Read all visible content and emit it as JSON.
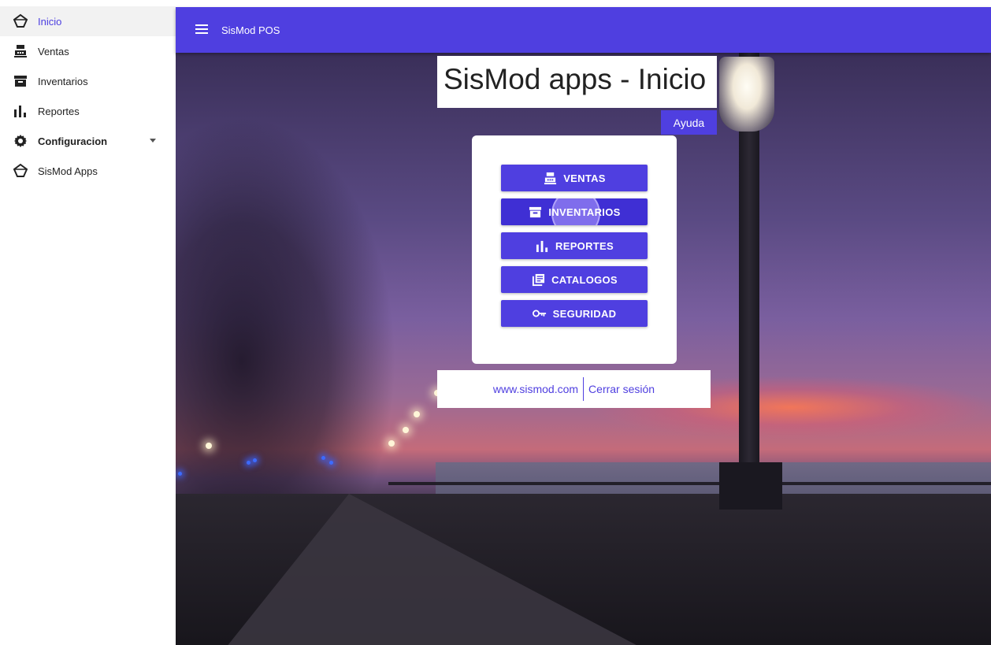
{
  "sidebar": {
    "items": [
      {
        "label": "Inicio",
        "icon": "sismod-logo-icon",
        "active": true
      },
      {
        "label": "Ventas",
        "icon": "cash-register-icon"
      },
      {
        "label": "Inventarios",
        "icon": "archive-icon"
      },
      {
        "label": "Reportes",
        "icon": "bar-chart-icon"
      },
      {
        "label": "Configuracion",
        "icon": "gear-icon",
        "expandable": true
      },
      {
        "label": "SisMod Apps",
        "icon": "sismod-logo-icon"
      }
    ]
  },
  "header": {
    "app_title": "SisMod POS",
    "accent_color": "#4f3fe0"
  },
  "main": {
    "title": "SisMod apps - Inicio",
    "help_label": "Ayuda",
    "modules": [
      {
        "label": "VENTAS",
        "icon": "cash-register-icon"
      },
      {
        "label": "INVENTARIOS",
        "icon": "archive-icon",
        "pressed": true
      },
      {
        "label": "REPORTES",
        "icon": "bar-chart-icon"
      },
      {
        "label": "CATALOGOS",
        "icon": "catalog-icon"
      },
      {
        "label": "SEGURIDAD",
        "icon": "key-icon"
      }
    ],
    "footer": {
      "website": "www.sismod.com",
      "logout": "Cerrar sesión"
    }
  }
}
